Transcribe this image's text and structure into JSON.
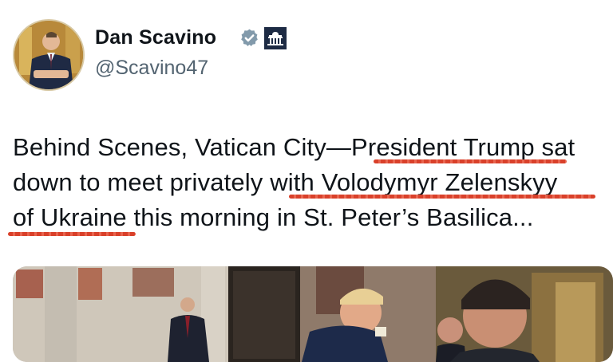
{
  "author": {
    "name": "Dan Scavino",
    "handle": "@Scavino47",
    "verified": true,
    "badges": [
      "verified-check-icon",
      "white-house-icon"
    ]
  },
  "tweet": {
    "lines": [
      "Behind Scenes, Vatican City—President Trump sat",
      "down to meet privately with Volodymyr Zelenskyy",
      "of Ukraine this morning in St. Peter’s Basilica..."
    ]
  },
  "colors": {
    "verified": "#829aab",
    "underline": "#d9402a",
    "text": "#0f1419",
    "handle": "#536471"
  }
}
